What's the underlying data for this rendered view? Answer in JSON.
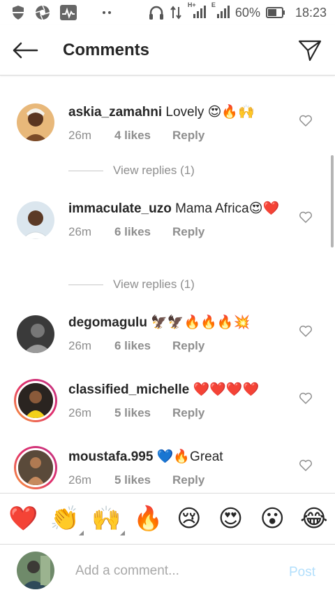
{
  "status_bar": {
    "battery": "60%",
    "time": "18:23",
    "network": "H+",
    "icons": [
      "shield-icon",
      "aperture-icon",
      "activity-icon",
      "dots-icon",
      "headphones-icon",
      "data-arrows-icon",
      "signal-icon",
      "signal-icon",
      "battery-icon"
    ]
  },
  "header": {
    "title": "Comments",
    "back_icon": "arrow-left-icon",
    "send_icon": "paper-plane-icon"
  },
  "comments": [
    {
      "user": "askia_zamahni",
      "text": "Lovely 😍🔥🙌",
      "time": "26m",
      "likes": "4 likes",
      "reply": "Reply"
    },
    {
      "user": "immaculate_uzo",
      "text": "Mama Africa😍❤️",
      "time": "26m",
      "likes": "6 likes",
      "reply": "Reply"
    },
    {
      "user": "degomagulu",
      "text": "🦅🦅🔥🔥🔥💥",
      "time": "26m",
      "likes": "6 likes",
      "reply": "Reply"
    },
    {
      "user": "classified_michelle",
      "text": "❤️❤️❤️❤️",
      "time": "26m",
      "likes": "5 likes",
      "reply": "Reply"
    },
    {
      "user": "moustafa.995",
      "text": "💙🔥Great",
      "time": "26m",
      "likes": "5 likes",
      "reply": "Reply"
    }
  ],
  "view_replies": [
    "View replies (1)",
    "View replies (1)"
  ],
  "emoji_bar": [
    "❤️",
    "👏",
    "🙌",
    "🔥",
    "😢",
    "😍",
    "😮",
    "😂"
  ],
  "composer": {
    "placeholder": "Add a comment...",
    "post_label": "Post"
  },
  "colors": {
    "text": "#262626",
    "muted": "#8e8e8e",
    "post_disabled": "#b2dffc",
    "heart_red": "#ed4956"
  }
}
